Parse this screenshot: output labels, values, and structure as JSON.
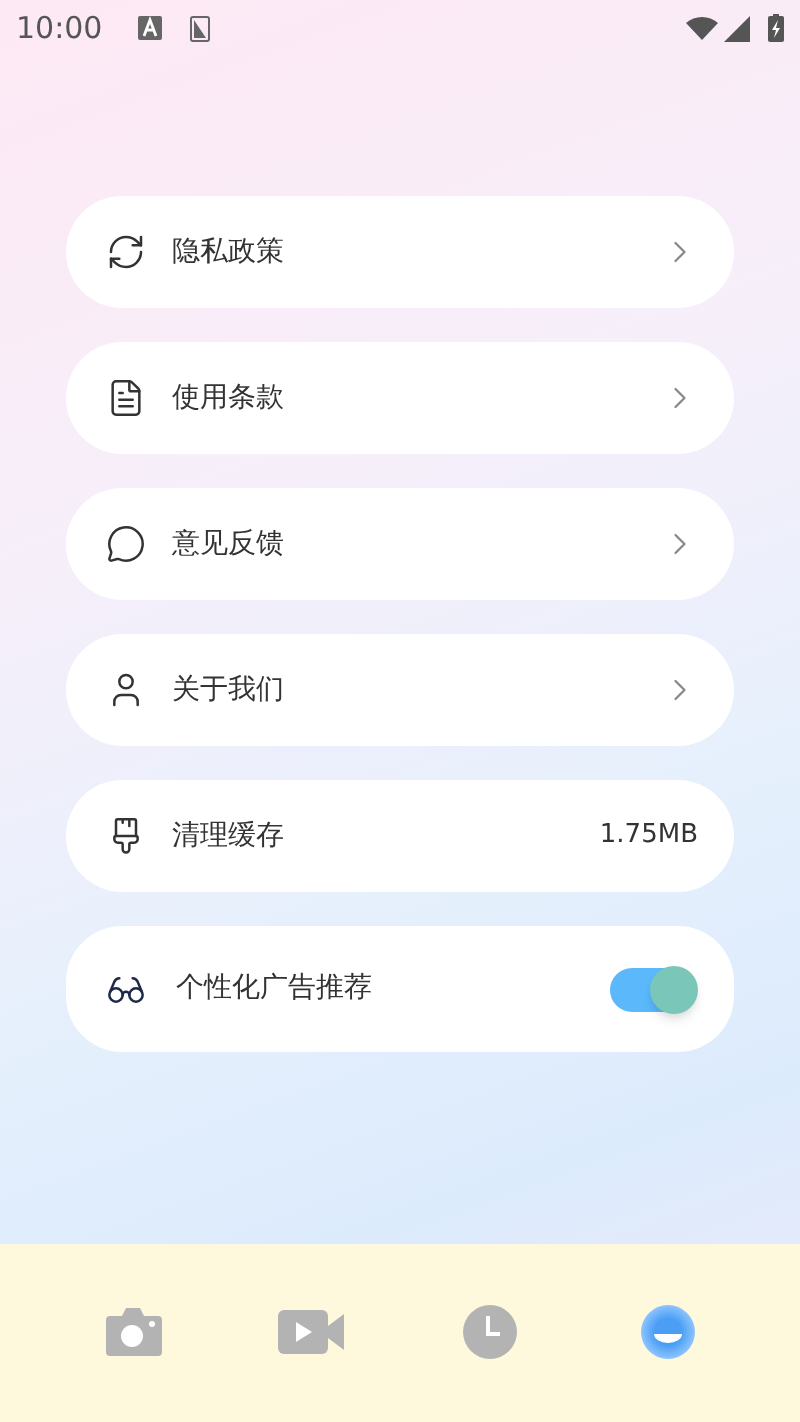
{
  "status_bar": {
    "time": "10:00"
  },
  "items": [
    {
      "kind": "link",
      "label": "隐私政策"
    },
    {
      "kind": "link",
      "label": "使用条款"
    },
    {
      "kind": "link",
      "label": "意见反馈"
    },
    {
      "kind": "link",
      "label": "关于我们"
    },
    {
      "kind": "value",
      "label": "清理缓存",
      "value": "1.75MB"
    },
    {
      "kind": "toggle",
      "label": "个性化广告推荐",
      "on": true
    }
  ],
  "tab_bar": [
    {
      "selected": false
    },
    {
      "selected": false
    },
    {
      "selected": false
    },
    {
      "selected": true
    }
  ]
}
